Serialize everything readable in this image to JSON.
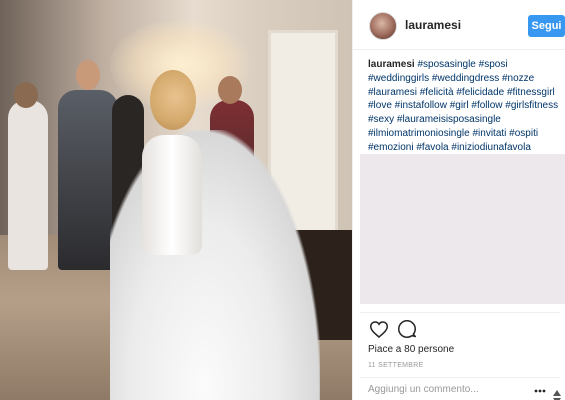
{
  "post": {
    "username": "lauramesi",
    "follow_label": "Segui",
    "caption_user": "lauramesi",
    "caption_text": "#sposasingle #sposi #weddinggirls #weddingdress #nozze #lauramesi #felicità #felicidade #fitnessgirl #love #instafollow #girl #follow #girlsfitness #sexy #laurameisisposasingle #ilmiomatrimoniosingle #invitati #ospiti #emozioni #favola #iniziodiunafavola",
    "likes_text": "Piace a 80 persone",
    "date_text": "11 SETTEMBRE",
    "comment_placeholder": "Aggiungi un commento..."
  },
  "icons": {
    "like": "heart-icon",
    "comment": "comment-bubble-icon",
    "more": "more-options-icon"
  },
  "colors": {
    "follow_button": "#3897f0",
    "link": "#003569",
    "placeholder_block": "#ede8eb"
  }
}
